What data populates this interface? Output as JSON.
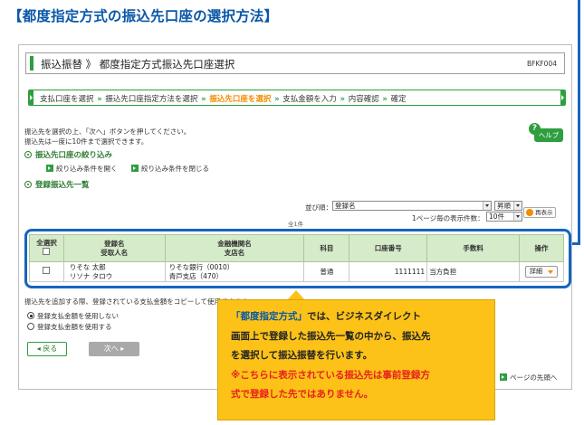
{
  "page_title": "【都度指定方式の振込先口座の選択方法】",
  "header": {
    "title": "振込振替 》 都度指定方式振込先口座選択",
    "screen_code": "BFKF004"
  },
  "steps": {
    "items": [
      "支払口座を選択",
      "振込先口座指定方法を選択",
      "振込先口座を選択",
      "支払金額を入力",
      "内容確認",
      "確定"
    ],
    "separator": "»"
  },
  "instructions": {
    "line1": "振込先を選択の上、「次へ」ボタンを押してください。",
    "line2": "振込先は一度に10件まで選択できます。"
  },
  "help": {
    "icon": "?",
    "label": "ヘルプ"
  },
  "filter_section": {
    "title": "振込先口座の絞り込み",
    "open_label": "絞り込み条件を開く",
    "close_label": "絞り込み条件を閉じる"
  },
  "list_section": {
    "title": "登録振込先一覧"
  },
  "sort": {
    "label": "並び順：",
    "field": "登録名",
    "order": "昇順",
    "per_page_label": "1ページ毎の表示件数：",
    "per_page": "10件",
    "redisplay": "再表示"
  },
  "top_note": "全1件",
  "table": {
    "headers": {
      "select_all": "全選択",
      "name_line1": "登録名",
      "name_line2": "受取人名",
      "bank_line1": "金融機関名",
      "bank_line2": "支店名",
      "type": "科目",
      "account": "口座番号",
      "fee": "手数料",
      "action": "操作"
    },
    "rows": [
      {
        "name_line1": "りそな 太郎",
        "name_line2": "リソナ タロウ",
        "bank_line1": "りそな銀行（0010）",
        "bank_line2": "青戸支店（470）",
        "type": "普通",
        "account": "1111111",
        "fee": "当方負担",
        "detail_label": "詳細"
      }
    ]
  },
  "note": "振込先を追加する際、登録されている支払金額をコピーして使用できます。",
  "amount_options": {
    "opt1": "登録支払金額を使用しない",
    "opt2": "登録支払金額を使用する"
  },
  "buttons": {
    "back": "戻る",
    "next": "次へ"
  },
  "page_top": "ページの先頭へ",
  "callout": {
    "line1_highlight": "「都度指定方式」",
    "line1_rest": "では、ビジネスダイレクト",
    "line2": "画面上で登録した振込先一覧の中から、振込先",
    "line3": "を選択して振込振替を行います。",
    "line4": "※こちらに表示されている振込先は事前登録方",
    "line5": "式で登録した先ではありません。"
  }
}
